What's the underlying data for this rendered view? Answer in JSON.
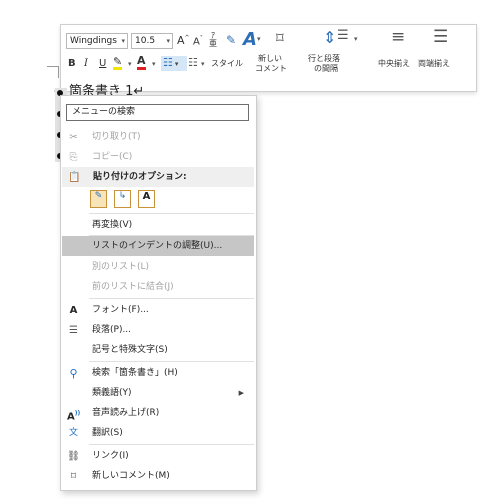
{
  "toolbar": {
    "font_name": "Wingdings",
    "font_size": "10.5",
    "grow_font": "A",
    "shrink_font": "A",
    "bold": "B",
    "italic": "I",
    "underline": "U",
    "style_label": "スタイル",
    "new_comment_label_1": "新しい",
    "new_comment_label_2": "コメント",
    "line_spacing_label_1": "行と段落",
    "line_spacing_label_2": "の間隔",
    "center_label": "中央揃え",
    "justify_label": "両端揃え"
  },
  "document": {
    "line_text": "→ 箇条書き 1↵"
  },
  "menu": {
    "search_label": "メニューの検索",
    "cut": "切り取り(T)",
    "copy": "コピー(C)",
    "paste_options": "貼り付けのオプション:",
    "reconvert": "再変換(V)",
    "adjust_indent": "リストのインデントの調整(U)...",
    "separate_list": "別のリスト(L)",
    "join_previous": "前のリストに結合(J)",
    "font": "フォント(F)...",
    "paragraph": "段落(P)...",
    "symbols": "記号と特殊文字(S)",
    "search_item": "検索「箇条書き」(H)",
    "synonyms": "類義語(Y)",
    "read_aloud": "音声読み上げ(R)",
    "translate": "翻訳(S)",
    "link": "リンク(I)",
    "new_comment": "新しいコメント(M)",
    "font_icon_letter": "A"
  }
}
